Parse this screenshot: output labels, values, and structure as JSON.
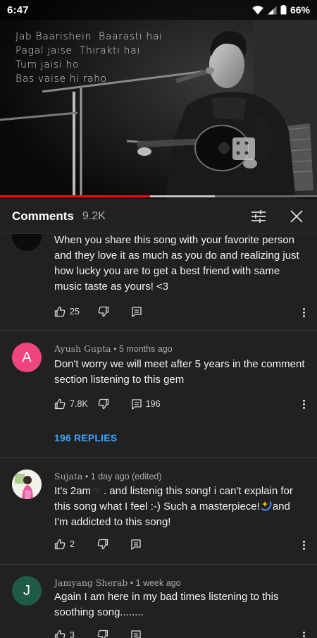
{
  "status_bar": {
    "time": "6:47",
    "battery": "66%"
  },
  "video": {
    "lyrics": [
      "Jab Baarishein  Baarasti hai",
      "Pagal jaise  Thirakti hai",
      "Tum jaisi ho",
      "Bas vaise hi raho"
    ],
    "progress": 0.47
  },
  "comments_panel": {
    "title": "Comments",
    "count": "9.2K"
  },
  "comments": [
    {
      "author": "",
      "meta": "",
      "text": "When you share this song with your favorite person and they love it as much as you do and realizing just how lucky you are to get a best friend with same music taste as yours! <3",
      "likes": "25",
      "replies": ""
    },
    {
      "avatar_letter": "A",
      "author": "Ayush Gupta",
      "meta": "5 months ago",
      "text": "Don't worry we will meet after 5 years in the comment section listening to this gem",
      "likes": "7.8K",
      "replies": "196",
      "replies_link": "196 REPLIES"
    },
    {
      "author": "Sujata",
      "meta": "1 day ago (edited)",
      "text_1": "It's 2am",
      "text_2": ".  and  listenig this song! i can't explain for this song what I feel :-) Such a masterpiece!",
      "text_3": "and I'm addicted to this song!",
      "likes": "2",
      "replies": ""
    },
    {
      "avatar_letter": "J",
      "author": "Jamyang Sherab",
      "meta": "1 week ago",
      "text": "Again I am here in my bad times listening to this soothing song........",
      "likes": "3",
      "replies": ""
    }
  ],
  "colors": {
    "background": "#212121",
    "accent_red": "#ff0000",
    "link_blue": "#3ea6ff",
    "avatar_pink": "#f0447d",
    "avatar_green": "#1e5b45"
  },
  "icons": {
    "filter": "tune-icon",
    "close": "close-icon",
    "like": "thumb-up-icon",
    "dislike": "thumb-down-icon",
    "reply": "comment-icon",
    "more": "more-vertical-icon"
  }
}
